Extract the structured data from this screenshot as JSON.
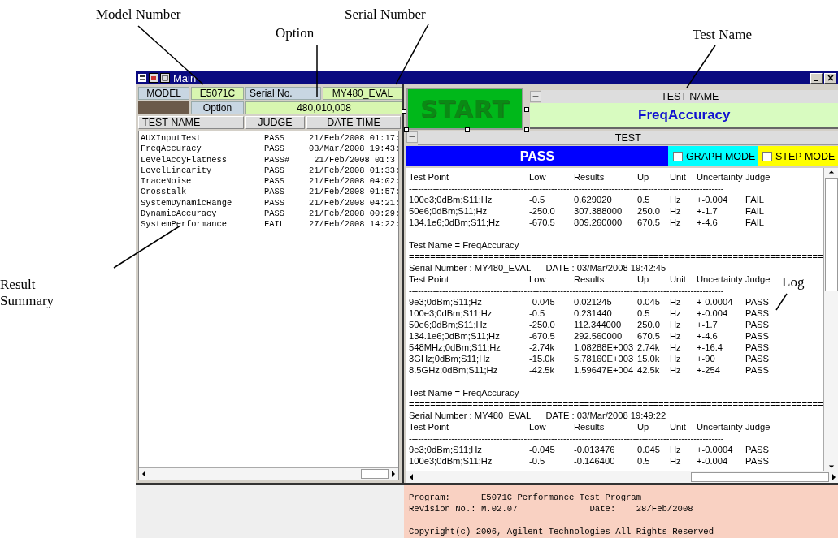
{
  "annotations": [
    {
      "text": "Model Number"
    },
    {
      "text": "Option"
    },
    {
      "text": "Serial Number"
    },
    {
      "text": "Test Name"
    },
    {
      "text": "Result Summary"
    },
    {
      "text": "Log"
    }
  ],
  "window": {
    "title": "Main"
  },
  "info": {
    "model_label": "MODEL",
    "model": "E5071C",
    "serial_label": "Serial No.",
    "serial": "MY480_EVAL",
    "option_label": "Option",
    "option": "480,010,008"
  },
  "summary": {
    "columns": [
      "TEST NAME",
      "JUDGE",
      "DATE TIME"
    ],
    "rows": [
      {
        "name": "AUXInputTest",
        "judge": "PASS",
        "date": "21/Feb/2008 01:17:"
      },
      {
        "name": "FreqAccuracy",
        "judge": "PASS",
        "date": "03/Mar/2008 19:43:"
      },
      {
        "name": "LevelAccyFlatness",
        "judge": "PASS#",
        "date": " 21/Feb/2008 01:3"
      },
      {
        "name": "LevelLinearity",
        "judge": "PASS",
        "date": "21/Feb/2008 01:33:"
      },
      {
        "name": "TraceNoise",
        "judge": "PASS",
        "date": "21/Feb/2008 04:02:"
      },
      {
        "name": "Crosstalk",
        "judge": "PASS",
        "date": "21/Feb/2008 01:57:"
      },
      {
        "name": "SystemDynamicRange",
        "judge": "PASS",
        "date": "21/Feb/2008 04:21:"
      },
      {
        "name": "DynamicAccuracy",
        "judge": "PASS",
        "date": "21/Feb/2008 00:29:"
      },
      {
        "name": "SystemPerformance",
        "judge": "FAIL",
        "date": "27/Feb/2008 14:22:"
      }
    ]
  },
  "start_button": "START",
  "test_name": {
    "header": "TEST NAME",
    "value": "FreqAccuracy"
  },
  "test": {
    "header": "TEST",
    "result": "PASS",
    "graph_mode": {
      "label": "GRAPH MODE",
      "checked": false
    },
    "step_mode": {
      "label": "STEP MODE",
      "checked": false
    }
  },
  "log": [
    {
      "kind": "cols",
      "cells": [
        "Test Point",
        "Low",
        "Results",
        "Up",
        "Unit",
        "Uncertainty",
        "Judge"
      ]
    },
    {
      "kind": "text",
      "text": "--------------------------------------------------------------------------------------------------------"
    },
    {
      "kind": "cols",
      "cells": [
        "100e3;0dBm;S11;Hz",
        "-0.5",
        "0.629020",
        "0.5",
        "Hz",
        "+-0.004",
        "FAIL"
      ]
    },
    {
      "kind": "cols",
      "cells": [
        "50e6;0dBm;S11;Hz",
        "-250.0",
        "307.388000",
        "250.0",
        "Hz",
        "+-1.7",
        "FAIL"
      ]
    },
    {
      "kind": "cols",
      "cells": [
        "134.1e6;0dBm;S11;Hz",
        "-670.5",
        "809.260000",
        "670.5",
        "Hz",
        "+-4.6",
        "FAIL"
      ]
    },
    {
      "kind": "blank"
    },
    {
      "kind": "text",
      "text": "Test Name = FreqAccuracy"
    },
    {
      "kind": "text",
      "text": "=============================================================================="
    },
    {
      "kind": "text",
      "text": "Serial Number : MY480_EVAL      DATE : 03/Mar/2008 19:42:45"
    },
    {
      "kind": "cols",
      "cells": [
        "Test Point",
        "Low",
        "Results",
        "Up",
        "Unit",
        "Uncertainty",
        "Judge"
      ]
    },
    {
      "kind": "text",
      "text": "--------------------------------------------------------------------------------------------------------"
    },
    {
      "kind": "cols",
      "cells": [
        "9e3;0dBm;S11;Hz",
        "-0.045",
        "0.021245",
        "0.045",
        "Hz",
        "+-0.0004",
        "PASS"
      ]
    },
    {
      "kind": "cols",
      "cells": [
        "100e3;0dBm;S11;Hz",
        "-0.5",
        "0.231440",
        "0.5",
        "Hz",
        "+-0.004",
        "PASS"
      ]
    },
    {
      "kind": "cols",
      "cells": [
        "50e6;0dBm;S11;Hz",
        "-250.0",
        "112.344000",
        "250.0",
        "Hz",
        "+-1.7",
        "PASS"
      ]
    },
    {
      "kind": "cols",
      "cells": [
        "134.1e6;0dBm;S11;Hz",
        "-670.5",
        "292.560000",
        "670.5",
        "Hz",
        "+-4.6",
        "PASS"
      ]
    },
    {
      "kind": "cols",
      "cells": [
        "548MHz;0dBm;S11;Hz",
        "-2.74k",
        "1.08288E+003",
        "2.74k",
        "Hz",
        "+-16.4",
        "PASS"
      ]
    },
    {
      "kind": "cols",
      "cells": [
        "3GHz;0dBm;S11;Hz",
        "-15.0k",
        "5.78160E+003",
        "15.0k",
        "Hz",
        "+-90",
        "PASS"
      ]
    },
    {
      "kind": "cols",
      "cells": [
        "8.5GHz;0dBm;S11;Hz",
        "-42.5k",
        "1.59647E+004",
        "42.5k",
        "Hz",
        "+-254",
        "PASS"
      ]
    },
    {
      "kind": "blank"
    },
    {
      "kind": "text",
      "text": "Test Name = FreqAccuracy"
    },
    {
      "kind": "text",
      "text": "=============================================================================="
    },
    {
      "kind": "text",
      "text": "Serial Number : MY480_EVAL      DATE : 03/Mar/2008 19:49:22"
    },
    {
      "kind": "cols",
      "cells": [
        "Test Point",
        "Low",
        "Results",
        "Up",
        "Unit",
        "Uncertainty",
        "Judge"
      ]
    },
    {
      "kind": "text",
      "text": "--------------------------------------------------------------------------------------------------------"
    },
    {
      "kind": "cols",
      "cells": [
        "9e3;0dBm;S11;Hz",
        "-0.045",
        "-0.013476",
        "0.045",
        "Hz",
        "+-0.0004",
        "PASS"
      ]
    },
    {
      "kind": "cols",
      "cells": [
        "100e3;0dBm;S11;Hz",
        "-0.5",
        "-0.146400",
        "0.5",
        "Hz",
        "+-0.004",
        "PASS"
      ]
    }
  ],
  "footer": {
    "program": "Program:      E5071C Performance Test Program",
    "revision": "Revision No.: M.02.07              Date:    28/Feb/2008",
    "copyright": "Copyright(c) 2006, Agilent Technologies All Rights Reserved"
  }
}
